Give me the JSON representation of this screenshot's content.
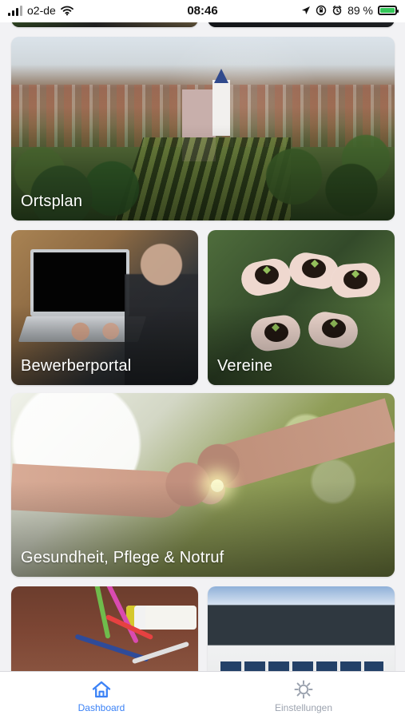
{
  "status_bar": {
    "carrier": "o2-de",
    "time": "08:46",
    "battery_percent": "89 %",
    "battery_level": 0.89
  },
  "tiles": {
    "ortsplan": "Ortsplan",
    "bewerberportal": "Bewerberportal",
    "vereine": "Vereine",
    "gesundheit": "Gesundheit, Pflege & Notruf"
  },
  "tab_bar": {
    "dashboard": "Dashboard",
    "settings": "Einstellungen"
  },
  "colors": {
    "active_tab": "#3b82f6",
    "inactive_tab": "#9ca3af",
    "battery_fill": "#34c759"
  }
}
